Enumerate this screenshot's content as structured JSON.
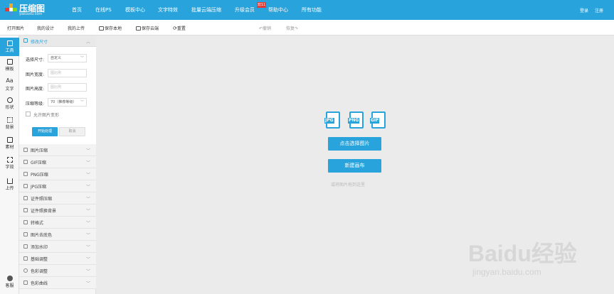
{
  "header": {
    "logo_title": "压缩图",
    "logo_sub": "yasuotu.com",
    "nav": [
      "首页",
      "在线PS",
      "模板中心",
      "文字特效",
      "批量云端压缩",
      "升级会员",
      "帮助中心",
      "所有功能"
    ],
    "hot_badge": "双11",
    "login": "登录",
    "register": "注册"
  },
  "toolbar": {
    "open": "打开图片",
    "my_design": "我的设计",
    "my_upload": "我的上传",
    "save_local": "保存本地",
    "save_cloud": "保存云端",
    "reset": "重置",
    "undo": "撤销",
    "redo": "恢复"
  },
  "rail": {
    "items": [
      "工具",
      "模板",
      "文字",
      "形状",
      "背景",
      "素材",
      "字效",
      "上传"
    ],
    "text_glyph": "Aa",
    "bottom": "客服"
  },
  "panel": {
    "header": "修改尺寸",
    "form": {
      "size_label": "选择尺寸:",
      "size_value": "自定义",
      "width_label": "图片宽度:",
      "width_placeholder": "图比例",
      "height_label": "图片高度:",
      "height_placeholder": "图比例",
      "level_label": "压缩等级:",
      "level_value": "70（推荐等级）",
      "allow_deform": "允许图片变形",
      "start_button": "开始处理",
      "cancel_button": "取消"
    },
    "sections": [
      "图片压缩",
      "GIF压缩",
      "PNG压缩",
      "JPG压缩",
      "证件照压缩",
      "证件照换背景",
      "转格式",
      "图片去底色",
      "添加水印",
      "基础调整",
      "色彩调整",
      "色彩曲线"
    ]
  },
  "canvas": {
    "file_types": [
      "JPG",
      "PNG",
      "GIF"
    ],
    "select_button": "点击选择图片",
    "new_button": "新建画布",
    "hint": "或将图片拖到这里"
  },
  "watermark": {
    "brand": "Baidu经验",
    "url": "jingyan.baidu.com"
  },
  "colors": {
    "accent": "#29a3dc",
    "badge": "#e53935"
  }
}
